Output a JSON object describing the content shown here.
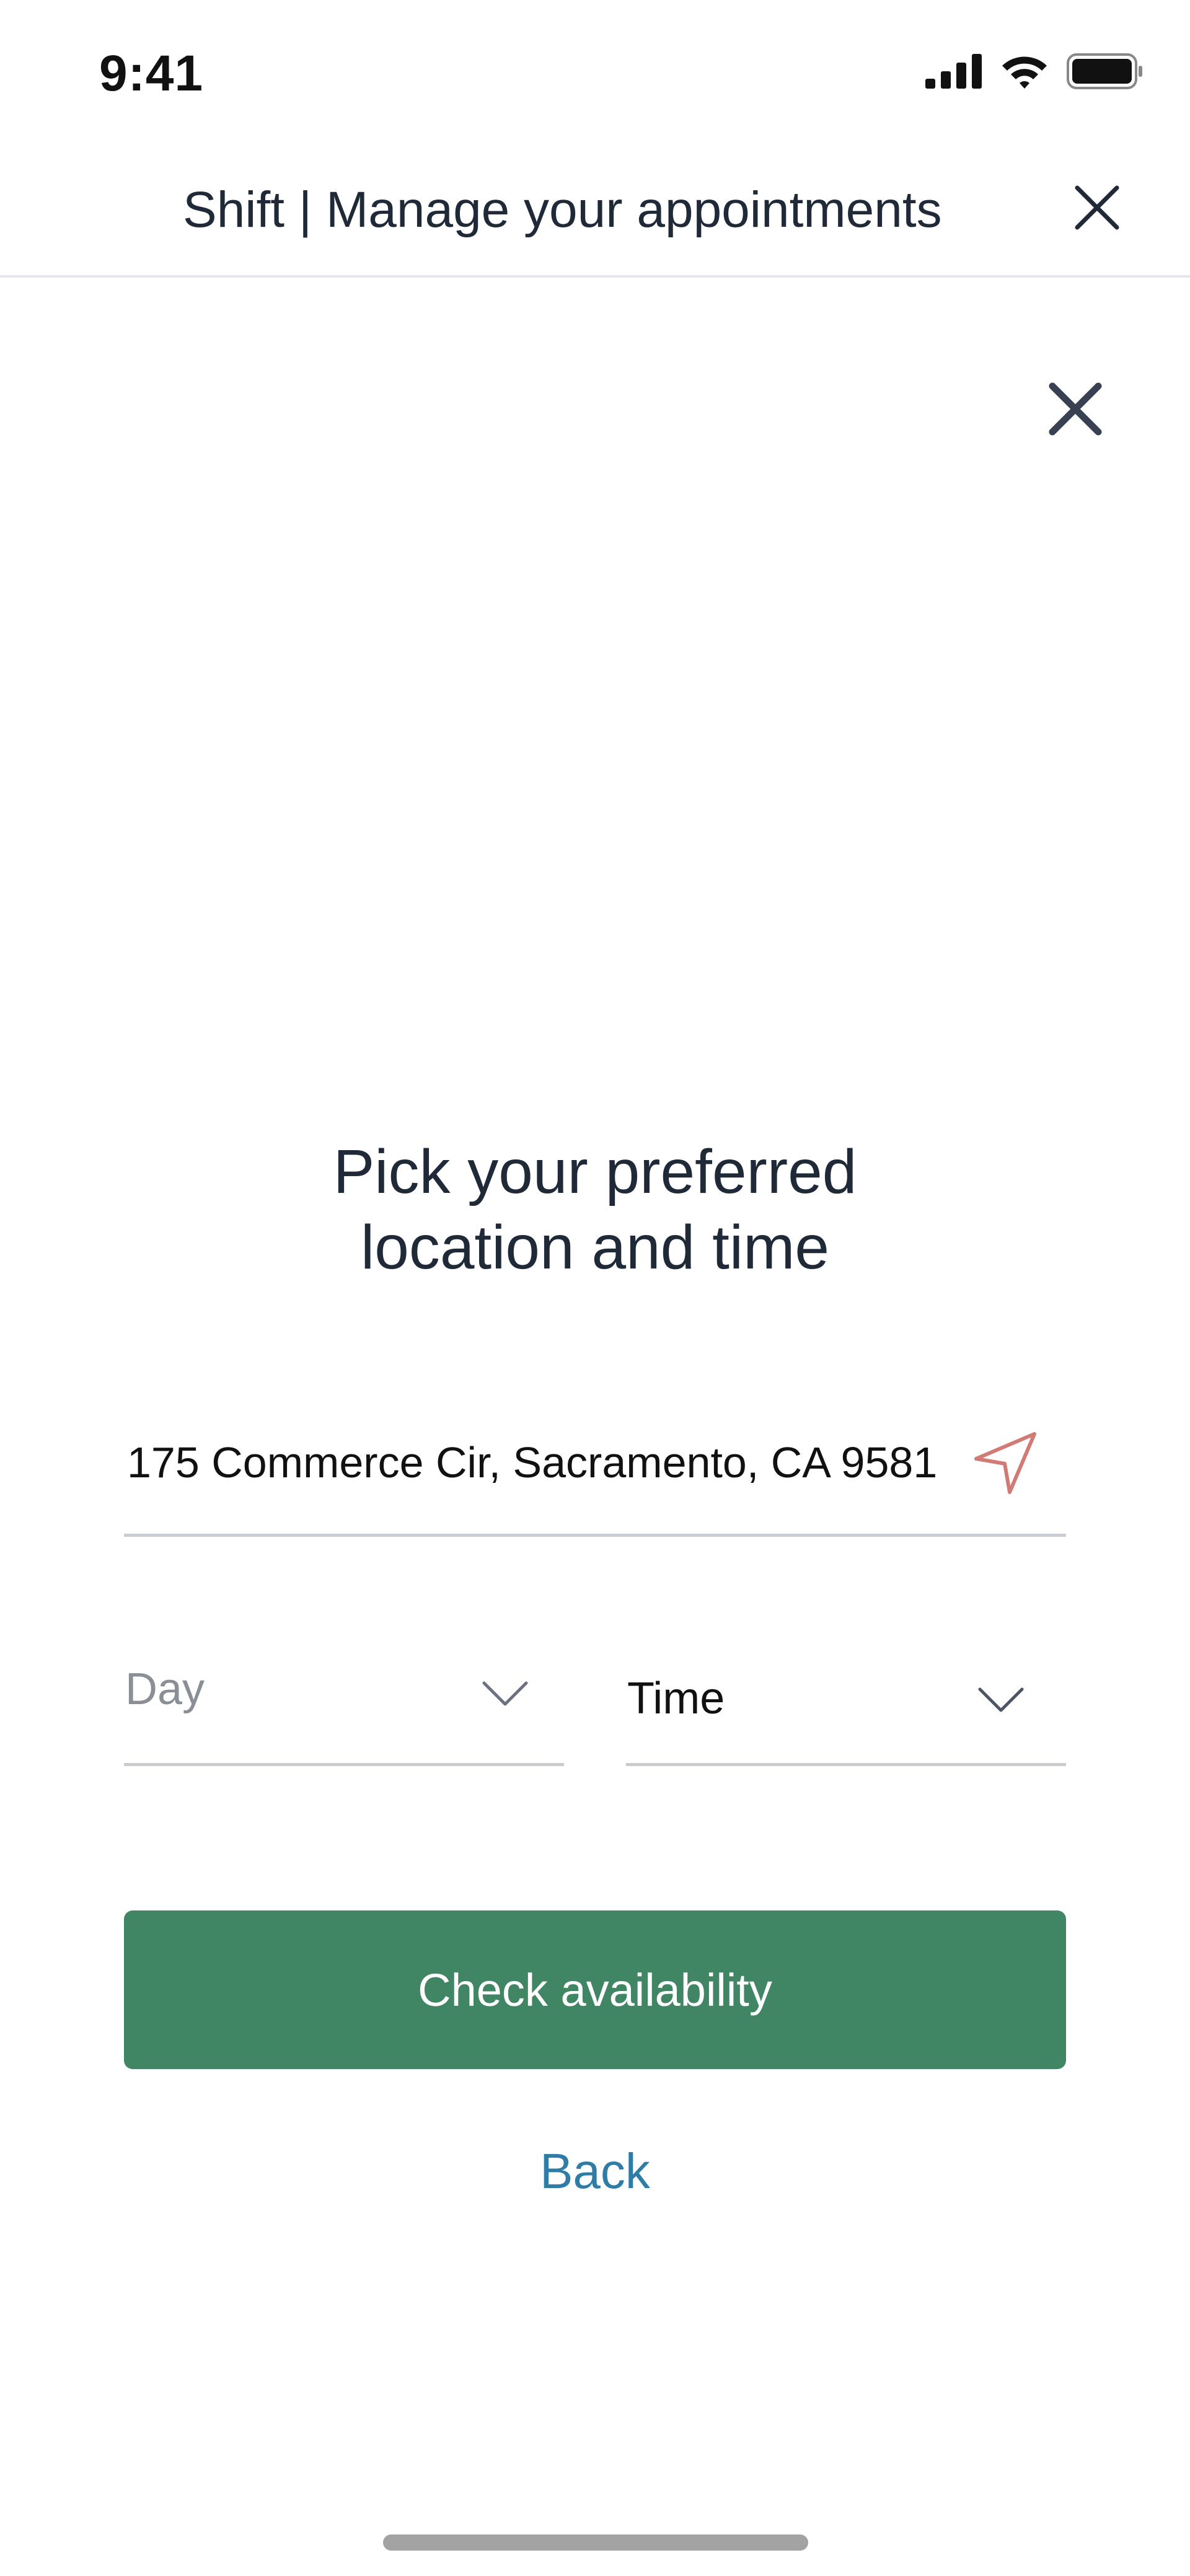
{
  "status_bar": {
    "time": "9:41",
    "icons": [
      "cellular-signal-icon",
      "wifi-icon",
      "battery-icon"
    ]
  },
  "header": {
    "title": "Shift | Manage your appointments",
    "close_icon": "close-icon"
  },
  "modal": {
    "close_icon": "close-icon",
    "heading_line1": "Pick your preferred",
    "heading_line2": "location and time"
  },
  "form": {
    "address_value": "175 Commerce Cir, Sacramento, CA 9581",
    "location_icon": "location-arrow-icon",
    "day_placeholder": "Day",
    "time_value": "Time",
    "chevron_icon": "chevron-down-icon"
  },
  "actions": {
    "check_label": "Check availability",
    "back_label": "Back"
  },
  "colors": {
    "primary_button": "#418664",
    "link": "#2f7ca6",
    "location_icon": "#d27a76",
    "divider": "#c9ccd1"
  }
}
